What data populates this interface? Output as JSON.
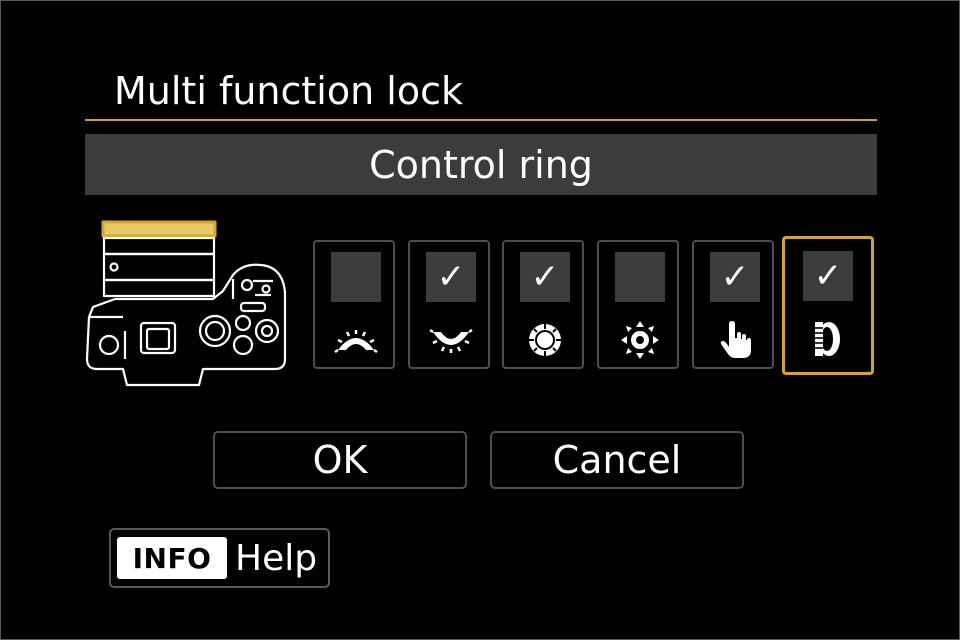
{
  "screen": {
    "title": "Multi function lock",
    "subtitle": "Control ring"
  },
  "options": [
    {
      "checked": false,
      "icon": "main-dial-icon",
      "mark": ""
    },
    {
      "checked": true,
      "icon": "quick-control-dial-icon",
      "mark": "✓"
    },
    {
      "checked": true,
      "icon": "quick-control-wheel-icon",
      "mark": "✓"
    },
    {
      "checked": false,
      "icon": "multi-controller-icon",
      "mark": ""
    },
    {
      "checked": true,
      "icon": "touch-control-icon",
      "mark": "✓"
    },
    {
      "checked": true,
      "icon": "control-ring-icon",
      "mark": "✓"
    }
  ],
  "selected_index": 5,
  "buttons": {
    "ok": "OK",
    "cancel": "Cancel"
  },
  "info": {
    "badge": "INFO",
    "label": "Help"
  },
  "colors": {
    "accent": "#d4a72c",
    "bar": "#3c3c3c",
    "border": "#4e4e4e"
  }
}
